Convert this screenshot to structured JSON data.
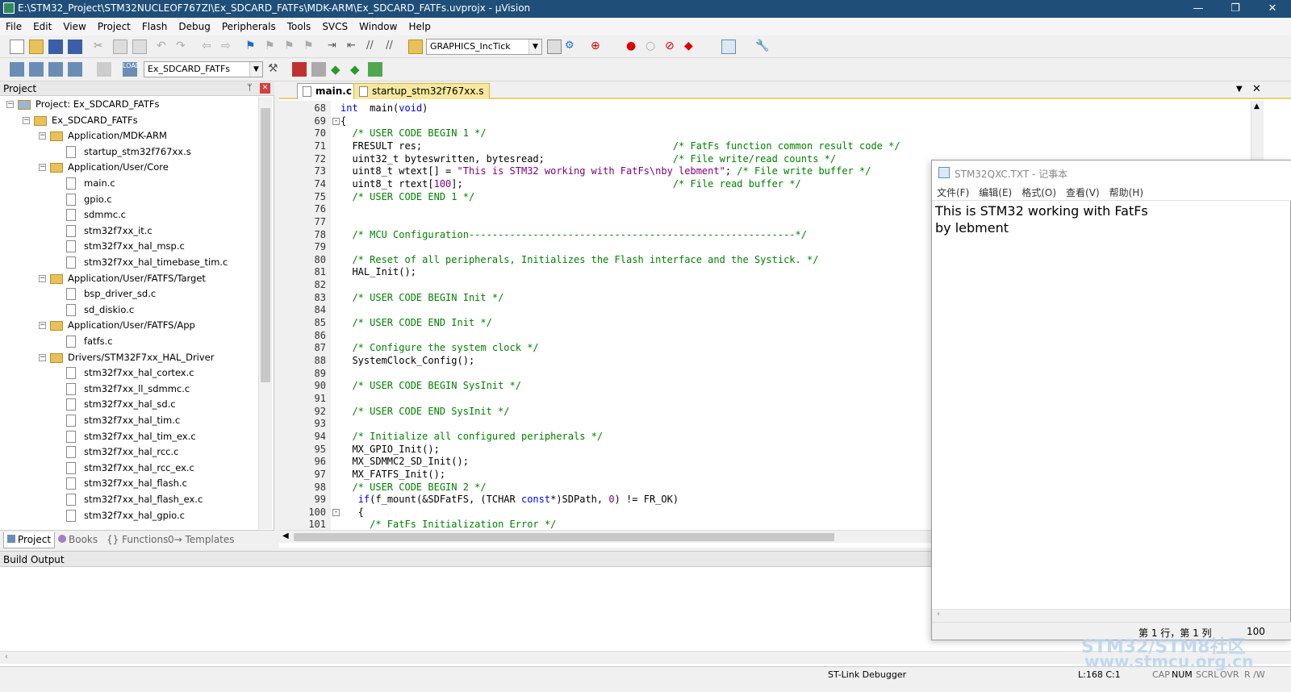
{
  "window": {
    "title": "E:\\STM32_Project\\STM32NUCLEOF767ZI\\Ex_SDCARD_FATFs\\MDK-ARM\\Ex_SDCARD_FATFs.uvprojx - µVision",
    "minimize": "—",
    "maximize": "❐",
    "close": "✕"
  },
  "menu": [
    "File",
    "Edit",
    "View",
    "Project",
    "Flash",
    "Debug",
    "Peripherals",
    "Tools",
    "SVCS",
    "Window",
    "Help"
  ],
  "toolbar1": {
    "find_combo": "GRAPHICS_IncTick"
  },
  "toolbar2": {
    "target_combo": "Ex_SDCARD_FATFs"
  },
  "project_panel": {
    "title": "Project",
    "pin": "ᛘ",
    "close": "✕",
    "root": "Project: Ex_SDCARD_FATFs",
    "target": "Ex_SDCARD_FATFs",
    "groups": [
      {
        "name": "Application/MDK-ARM",
        "files": [
          "startup_stm32f767xx.s"
        ]
      },
      {
        "name": "Application/User/Core",
        "files": [
          "main.c",
          "gpio.c",
          "sdmmc.c",
          "stm32f7xx_it.c",
          "stm32f7xx_hal_msp.c",
          "stm32f7xx_hal_timebase_tim.c"
        ]
      },
      {
        "name": "Application/User/FATFS/Target",
        "files": [
          "bsp_driver_sd.c",
          "sd_diskio.c"
        ]
      },
      {
        "name": "Application/User/FATFS/App",
        "files": [
          "fatfs.c"
        ]
      },
      {
        "name": "Drivers/STM32F7xx_HAL_Driver",
        "files": [
          "stm32f7xx_hal_cortex.c",
          "stm32f7xx_ll_sdmmc.c",
          "stm32f7xx_hal_sd.c",
          "stm32f7xx_hal_tim.c",
          "stm32f7xx_hal_tim_ex.c",
          "stm32f7xx_hal_rcc.c",
          "stm32f7xx_hal_rcc_ex.c",
          "stm32f7xx_hal_flash.c",
          "stm32f7xx_hal_flash_ex.c",
          "stm32f7xx_hal_gpio.c"
        ]
      }
    ],
    "tabs": [
      "Project",
      "Books",
      "{} Functions",
      "0→ Templates"
    ]
  },
  "editor": {
    "tabs": [
      "main.c",
      "startup_stm32f767xx.s"
    ],
    "lines": [
      {
        "n": "68",
        "segs": [
          [
            "kw",
            "int"
          ],
          [
            "",
            "  main("
          ],
          [
            "kw",
            "void"
          ],
          [
            "",
            ")"
          ]
        ]
      },
      {
        "n": "69",
        "fold": "-",
        "segs": [
          [
            "",
            "{"
          ]
        ]
      },
      {
        "n": "70",
        "segs": [
          [
            "cm",
            "  /* USER CODE BEGIN 1 */"
          ]
        ]
      },
      {
        "n": "71",
        "segs": [
          [
            "",
            "  FRESULT res;                                           "
          ],
          [
            "cm",
            "/* FatFs function common result code */"
          ]
        ]
      },
      {
        "n": "72",
        "segs": [
          [
            "",
            "  uint32_t byteswritten, bytesread;                      "
          ],
          [
            "cm",
            "/* File write/read counts */"
          ]
        ]
      },
      {
        "n": "73",
        "segs": [
          [
            "",
            "  uint8_t wtext[] = "
          ],
          [
            "st",
            "\"This is STM32 working with FatFs\\nby lebment\""
          ],
          [
            "",
            "; "
          ],
          [
            "cm",
            "/* File write buffer */"
          ]
        ]
      },
      {
        "n": "74",
        "segs": [
          [
            "",
            "  uint8_t rtext["
          ],
          [
            "st",
            "100"
          ],
          [
            "",
            "];                                    "
          ],
          [
            "cm",
            "/* File read buffer */"
          ]
        ]
      },
      {
        "n": "75",
        "segs": [
          [
            "cm",
            "  /* USER CODE END 1 */"
          ]
        ]
      },
      {
        "n": "76",
        "segs": [
          [
            "",
            ""
          ]
        ]
      },
      {
        "n": "77",
        "segs": [
          [
            "",
            ""
          ]
        ]
      },
      {
        "n": "78",
        "segs": [
          [
            "cm",
            "  /* MCU Configuration--------------------------------------------------------*/"
          ]
        ]
      },
      {
        "n": "79",
        "segs": [
          [
            "",
            ""
          ]
        ]
      },
      {
        "n": "80",
        "segs": [
          [
            "cm",
            "  /* Reset of all peripherals, Initializes the Flash interface and the Systick. */"
          ]
        ]
      },
      {
        "n": "81",
        "segs": [
          [
            "",
            "  HAL_Init();"
          ]
        ]
      },
      {
        "n": "82",
        "segs": [
          [
            "",
            ""
          ]
        ]
      },
      {
        "n": "83",
        "segs": [
          [
            "cm",
            "  /* USER CODE BEGIN Init */"
          ]
        ]
      },
      {
        "n": "84",
        "segs": [
          [
            "",
            ""
          ]
        ]
      },
      {
        "n": "85",
        "segs": [
          [
            "cm",
            "  /* USER CODE END Init */"
          ]
        ]
      },
      {
        "n": "86",
        "segs": [
          [
            "",
            ""
          ]
        ]
      },
      {
        "n": "87",
        "segs": [
          [
            "cm",
            "  /* Configure the system clock */"
          ]
        ]
      },
      {
        "n": "88",
        "segs": [
          [
            "",
            "  SystemClock_Config();"
          ]
        ]
      },
      {
        "n": "89",
        "segs": [
          [
            "",
            ""
          ]
        ]
      },
      {
        "n": "90",
        "segs": [
          [
            "cm",
            "  /* USER CODE BEGIN SysInit */"
          ]
        ]
      },
      {
        "n": "91",
        "segs": [
          [
            "",
            ""
          ]
        ]
      },
      {
        "n": "92",
        "segs": [
          [
            "cm",
            "  /* USER CODE END SysInit */"
          ]
        ]
      },
      {
        "n": "93",
        "segs": [
          [
            "",
            ""
          ]
        ]
      },
      {
        "n": "94",
        "segs": [
          [
            "cm",
            "  /* Initialize all configured peripherals */"
          ]
        ]
      },
      {
        "n": "95",
        "segs": [
          [
            "",
            "  MX_GPIO_Init();"
          ]
        ]
      },
      {
        "n": "96",
        "segs": [
          [
            "",
            "  MX_SDMMC2_SD_Init();"
          ]
        ]
      },
      {
        "n": "97",
        "segs": [
          [
            "",
            "  MX_FATFS_Init();"
          ]
        ]
      },
      {
        "n": "98",
        "segs": [
          [
            "cm",
            "  /* USER CODE BEGIN 2 */"
          ]
        ]
      },
      {
        "n": "99",
        "segs": [
          [
            "",
            "   "
          ],
          [
            "kw",
            "if"
          ],
          [
            "",
            "(f_mount(&SDFatFS, (TCHAR "
          ],
          [
            "kw",
            "const"
          ],
          [
            "",
            "*)SDPath, "
          ],
          [
            "st",
            "0"
          ],
          [
            "",
            ") != FR_OK)"
          ]
        ]
      },
      {
        "n": "100",
        "fold": "-",
        "segs": [
          [
            "",
            "   {"
          ]
        ]
      },
      {
        "n": "101",
        "segs": [
          [
            "cm",
            "     /* FatFs Initialization Error */"
          ]
        ]
      }
    ]
  },
  "build_output": {
    "title": "Build Output"
  },
  "statusbar": {
    "debugger": "ST-Link Debugger",
    "position": "L:168 C:1",
    "cap": "CAP",
    "num": "NUM",
    "scrl": "SCRL",
    "ovr": "OVR",
    "rw": "R /W"
  },
  "notepad": {
    "title": "STM32QXC.TXT - 记事本",
    "menu": [
      "文件(F)",
      "编辑(E)",
      "格式(O)",
      "查看(V)",
      "帮助(H)"
    ],
    "line1": "This is STM32 working with FatFs",
    "line2": "by lebment",
    "cursor": "第 1 行，第 1 列",
    "zoom": "100"
  },
  "watermark": {
    "line1": "STM32/STM8社区",
    "line2": "www.stmcu.org.cn"
  },
  "colors": {
    "titlebar": "#1f4e79",
    "comment": "#008000",
    "keyword": "#0000ff",
    "string": "#800080"
  }
}
